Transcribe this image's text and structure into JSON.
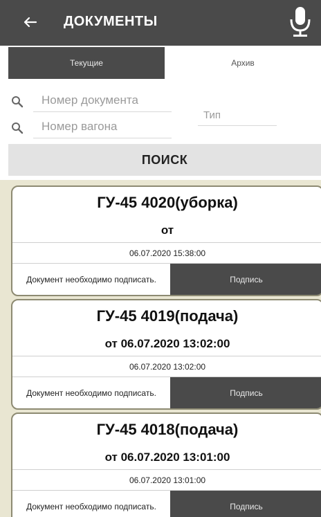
{
  "appbar": {
    "title": "ДОКУМЕНТЫ",
    "back_icon": "arrow-left-icon",
    "mic_icon": "microphone-icon",
    "background": "#4a4a4a"
  },
  "tabs": [
    {
      "label": "Текущие",
      "active": true
    },
    {
      "label": "Архив",
      "active": false
    }
  ],
  "search": {
    "doc_number_placeholder": "Номер документа",
    "wagon_number_placeholder": "Номер вагона",
    "type_placeholder": "Тип",
    "button_label": "ПОИСК"
  },
  "documents": [
    {
      "title": "ГУ-45 4020(уборка)",
      "from": "от",
      "date": "06.07.2020 15:38:00",
      "message": "Документ необходимо подписать.",
      "sign_label": "Подпись"
    },
    {
      "title": "ГУ-45 4019(подача)",
      "from": "от 06.07.2020 13:02:00",
      "date": "06.07.2020 13:02:00",
      "message": "Документ необходимо подписать.",
      "sign_label": "Подпись"
    },
    {
      "title": "ГУ-45 4018(подача)",
      "from": "от 06.07.2020 13:01:00",
      "date": "06.07.2020 13:01:00",
      "message": "Документ необходимо подписать.",
      "sign_label": "Подпись"
    }
  ],
  "colors": {
    "dark": "#4a4a4a",
    "list_background": "#e9e6d2",
    "card_border": "#8d8a72",
    "search_button": "#e3e3e3"
  }
}
